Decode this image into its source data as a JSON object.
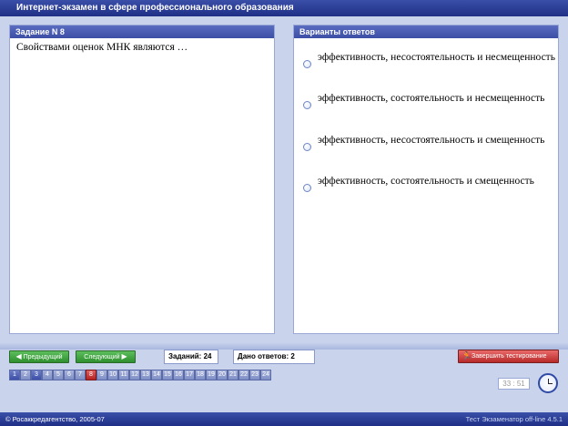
{
  "window": {
    "title": "Интернет-экзамен в сфере профессионального образования"
  },
  "question_panel": {
    "header": "Задание N 8",
    "text": "Свойствами оценок МНК являются …"
  },
  "answers_panel": {
    "header": "Варианты ответов",
    "options": [
      {
        "text": "эффективность, несостоятельность и несмещенность"
      },
      {
        "text": "эффективность, состоятельность и несмещенность"
      },
      {
        "text": "эффективность, несостоятельность и смещенность"
      },
      {
        "text": "эффективность, состоятельность и смещенность"
      }
    ]
  },
  "toolbar": {
    "prev_label": "Предыдущий",
    "next_label": "Следующий",
    "tasks_label": "Заданий:",
    "tasks_value": "24",
    "answered_label": "Дано ответов:",
    "answered_value": "2",
    "finish_label": "Завершить тестирование"
  },
  "question_numbers": [
    "1",
    "2",
    "3",
    "4",
    "5",
    "6",
    "7",
    "8",
    "9",
    "10",
    "11",
    "12",
    "13",
    "14",
    "15",
    "16",
    "17",
    "18",
    "19",
    "20",
    "21",
    "22",
    "23",
    "24"
  ],
  "current_question": "8",
  "timer": "33 : 51",
  "footer": {
    "left": "© Росаккредагентство, 2005-07",
    "right": "Тест Экзаменатор off-line 4.5.1"
  },
  "icons": {
    "prev": "arrow-left-icon",
    "next": "arrow-right-icon",
    "finish": "runner-icon",
    "clock": "clock-icon"
  },
  "colors": {
    "title_bar": "#1f2f86",
    "nav_button": "#2f8f2f",
    "finish_button": "#b82a2a",
    "active_question": "#b52222"
  }
}
